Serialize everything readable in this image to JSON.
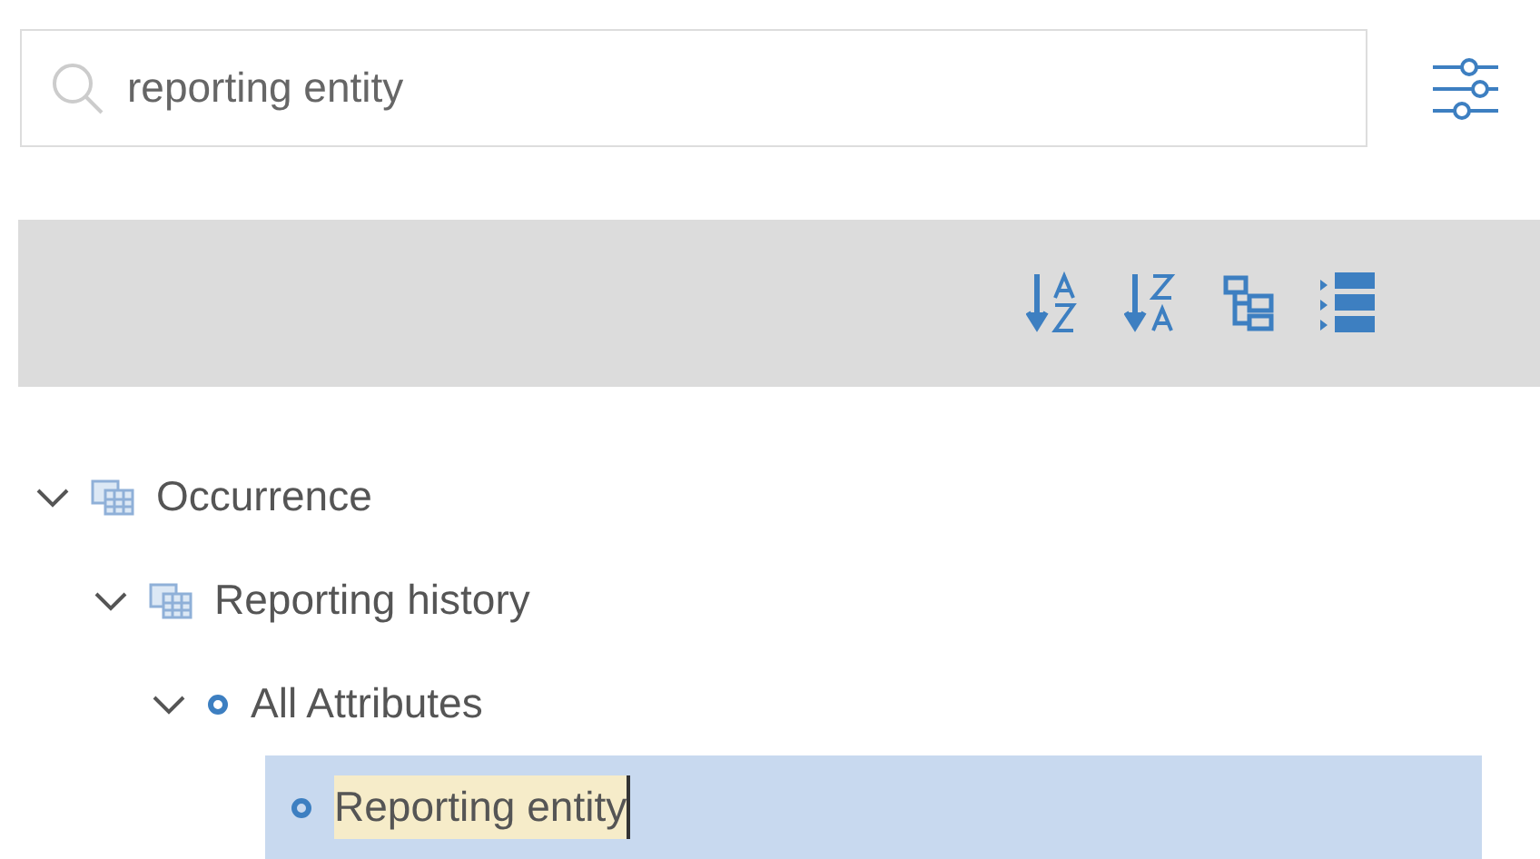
{
  "search": {
    "value": "reporting entity"
  },
  "toolbar": {
    "buttons": [
      {
        "kind": "sort-asc"
      },
      {
        "kind": "sort-desc"
      },
      {
        "kind": "hierarchy"
      },
      {
        "kind": "list"
      }
    ]
  },
  "tree": [
    {
      "kind": "table",
      "label": "Occurrence",
      "expanded": true,
      "selected": false,
      "match": false,
      "children": [
        {
          "kind": "table",
          "label": "Reporting history",
          "expanded": true,
          "selected": false,
          "match": false,
          "children": [
            {
              "kind": "attribute",
              "label": "All Attributes",
              "expanded": true,
              "selected": false,
              "match": false,
              "children": [
                {
                  "kind": "attribute",
                  "label": "Reporting entity",
                  "selected": true,
                  "match": true
                }
              ]
            }
          ]
        }
      ]
    }
  ]
}
